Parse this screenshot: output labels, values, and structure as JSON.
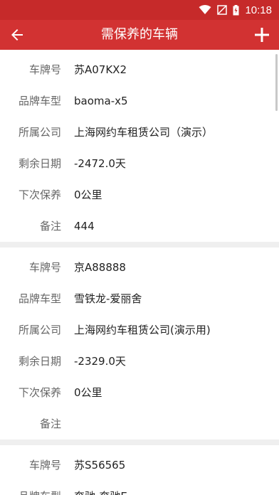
{
  "status_bar": {
    "time": "10:18"
  },
  "app_bar": {
    "title": "需保养的车辆"
  },
  "cards": [
    {
      "plate_label": "车牌号",
      "plate": "苏A07KX2",
      "model_label": "品牌车型",
      "model": "baoma-x5",
      "company_label": "所属公司",
      "company": "上海网约车租赁公司（演示）",
      "days_label": "剩余日期",
      "days": "-2472.0天",
      "next_label": "下次保养",
      "next": "0公里",
      "remark_label": "备注",
      "remark": "444"
    },
    {
      "plate_label": "车牌号",
      "plate": "京A88888",
      "model_label": "品牌车型",
      "model": "雪铁龙-爱丽舍",
      "company_label": "所属公司",
      "company": "上海网约车租赁公司(演示用)",
      "days_label": "剩余日期",
      "days": "-2329.0天",
      "next_label": "下次保养",
      "next": "0公里",
      "remark_label": "备注",
      "remark": ""
    },
    {
      "plate_label": "车牌号",
      "plate": "苏S56565",
      "model_label": "品牌车型",
      "model": "奔驰-奔驰E"
    }
  ]
}
